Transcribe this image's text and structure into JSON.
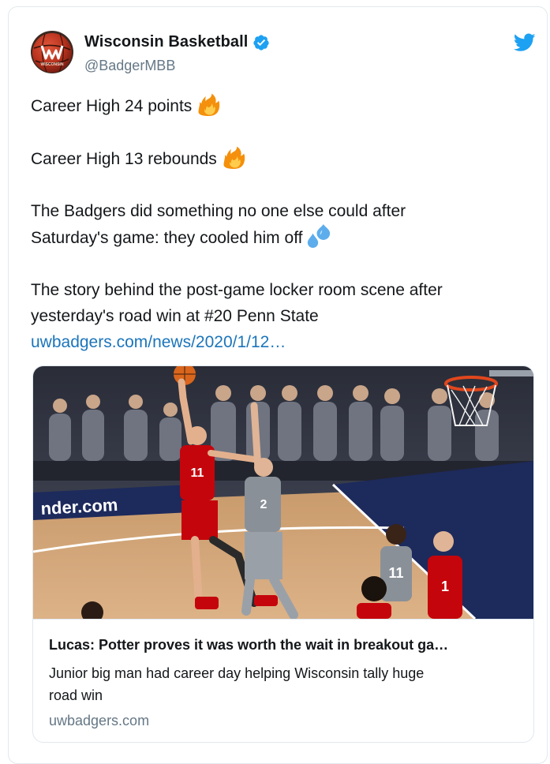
{
  "author": {
    "display_name": "Wisconsin Basketball",
    "handle": "@BadgerMBB",
    "avatar_icon": "wisconsin-basketball-logo-icon",
    "verified": true
  },
  "tweet": {
    "line1": "Career High 24 points",
    "line2": "Career High 13 rebounds",
    "line3a": "The Badgers did something no one else could after",
    "line3b": "Saturday's game: they cooled him off",
    "line4a": "The story behind the post-game locker room scene after",
    "line4b": "yesterday's road win at #20 Penn State",
    "link": "uwbadgers.com/news/2020/1/12…",
    "emojis": [
      "fire-emoji",
      "fire-emoji",
      "sweat-droplets-emoji"
    ]
  },
  "card": {
    "image_icon": "basketball-game-photo",
    "title": "Lucas: Potter proves it was worth the wait in breakout ga…",
    "desc_line1": "Junior big man had career day helping Wisconsin tally huge",
    "desc_line2": "road win",
    "domain": "uwbadgers.com"
  },
  "colors": {
    "twitter_blue": "#1da1f2",
    "link": "#1b75bb",
    "secondary_text": "#657786",
    "border": "#e1e8ed"
  }
}
